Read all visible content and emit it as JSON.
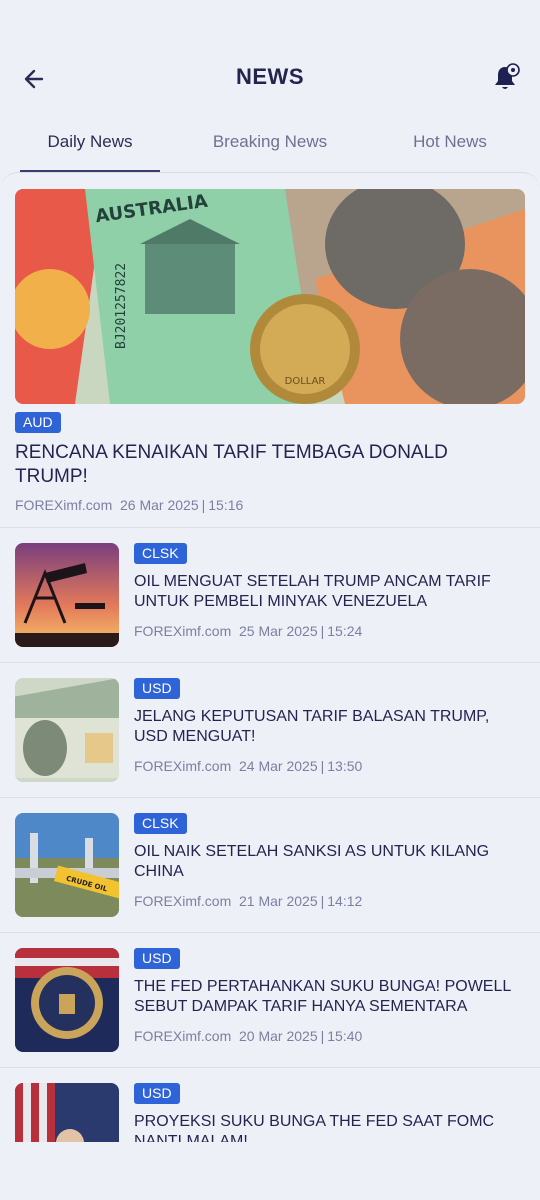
{
  "header": {
    "title": "NEWS"
  },
  "tabs": [
    {
      "label": "Daily News",
      "active": true
    },
    {
      "label": "Breaking News",
      "active": false
    },
    {
      "label": "Hot News",
      "active": false
    }
  ],
  "colors": {
    "accent": "#2f63d8",
    "text": "#23254f",
    "background": "#eef0f7"
  },
  "featured": {
    "badge": "AUD",
    "title": "RENCANA KENAIKAN TARIF TEMBAGA DONALD TRUMP!",
    "source": "FOREXimf.com",
    "date": "26 Mar 2025",
    "time": "15:16",
    "image_text": {
      "country": "AUSTRALIA",
      "serial": "BJ201257822",
      "coin": "DOLLAR"
    }
  },
  "items": [
    {
      "badge": "CLSK",
      "title": "OIL MENGUAT SETELAH TRUMP ANCAM TARIF UNTUK PEMBELI MINYAK VENEZUELA",
      "source": "FOREXimf.com",
      "date": "25 Mar 2025",
      "time": "15:24"
    },
    {
      "badge": "USD",
      "title": "JELANG KEPUTUSAN TARIF BALASAN TRUMP, USD MENGUAT!",
      "source": "FOREXimf.com",
      "date": "24 Mar 2025",
      "time": "13:50"
    },
    {
      "badge": "CLSK",
      "title": "OIL NAIK SETELAH SANKSI AS UNTUK KILANG CHINA",
      "source": "FOREXimf.com",
      "date": "21 Mar 2025",
      "time": "14:12",
      "image_text": "CRUDE OIL"
    },
    {
      "badge": "USD",
      "title": "THE FED PERTAHANKAN SUKU BUNGA! POWELL SEBUT DAMPAK TARIF HANYA SEMENTARA",
      "source": "FOREXimf.com",
      "date": "20 Mar 2025",
      "time": "15:40"
    },
    {
      "badge": "USD",
      "title": "PROYEKSI SUKU BUNGA THE FED SAAT FOMC NANTI MALAM!",
      "source": "",
      "date": "",
      "time": ""
    }
  ]
}
